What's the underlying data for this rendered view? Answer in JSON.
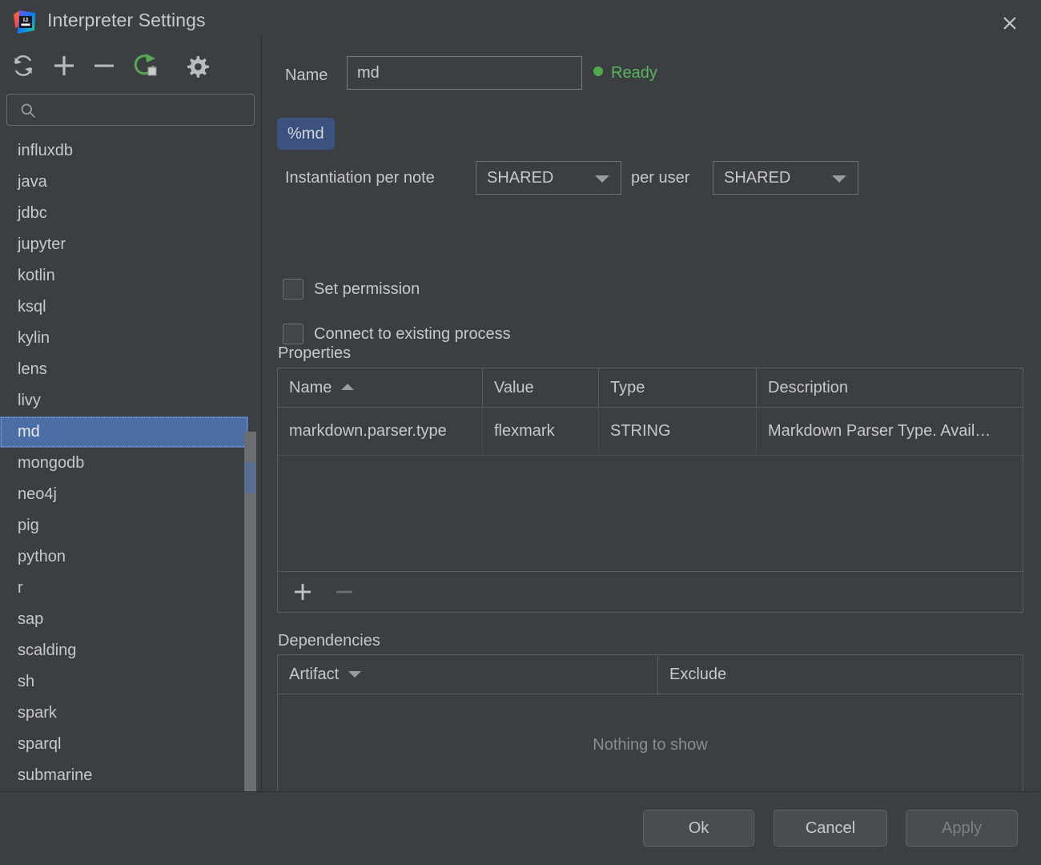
{
  "window": {
    "title": "Interpreter Settings",
    "logo_icon": "intellij-idea-logo",
    "close_icon": "close-icon"
  },
  "sidebar": {
    "toolbar": [
      {
        "name": "refresh-button",
        "icon": "refresh-icon",
        "title": "Refresh"
      },
      {
        "name": "add-button",
        "icon": "plus-icon",
        "title": "Add"
      },
      {
        "name": "remove-button",
        "icon": "minus-icon",
        "title": "Remove"
      },
      {
        "name": "restart-button",
        "icon": "restart-icon",
        "title": "Restart"
      },
      {
        "name": "settings-button",
        "icon": "gear-icon",
        "title": "Settings"
      }
    ],
    "search": {
      "value": "",
      "placeholder": "",
      "icon": "search-icon"
    },
    "items": [
      {
        "label": "influxdb",
        "selected": false
      },
      {
        "label": "java",
        "selected": false
      },
      {
        "label": "jdbc",
        "selected": false
      },
      {
        "label": "jupyter",
        "selected": false
      },
      {
        "label": "kotlin",
        "selected": false
      },
      {
        "label": "ksql",
        "selected": false
      },
      {
        "label": "kylin",
        "selected": false
      },
      {
        "label": "lens",
        "selected": false
      },
      {
        "label": "livy",
        "selected": false
      },
      {
        "label": "md",
        "selected": true
      },
      {
        "label": "mongodb",
        "selected": false
      },
      {
        "label": "neo4j",
        "selected": false
      },
      {
        "label": "pig",
        "selected": false
      },
      {
        "label": "python",
        "selected": false
      },
      {
        "label": "r",
        "selected": false
      },
      {
        "label": "sap",
        "selected": false
      },
      {
        "label": "scalding",
        "selected": false
      },
      {
        "label": "sh",
        "selected": false
      },
      {
        "label": "spark",
        "selected": false
      },
      {
        "label": "sparql",
        "selected": false
      },
      {
        "label": "submarine",
        "selected": false
      }
    ]
  },
  "detail": {
    "name_label": "Name",
    "name_value": "md",
    "status_text": "Ready",
    "status_color": "#51a94f",
    "badge": "%md",
    "instantiation_label": "Instantiation per note",
    "per_note_value": "SHARED",
    "per_user_label": "per user",
    "per_user_value": "SHARED",
    "set_permission_label": "Set permission",
    "set_permission_checked": false,
    "connect_existing_label": "Connect to existing process",
    "connect_existing_checked": false,
    "properties": {
      "title": "Properties",
      "columns": [
        "Name",
        "Value",
        "Type",
        "Description"
      ],
      "sort_column": "Name",
      "sort_direction": "asc",
      "rows": [
        {
          "name": "markdown.parser.type",
          "value": "flexmark",
          "type": "STRING",
          "description": "Markdown Parser Type. Avail…"
        }
      ],
      "add_label": "+",
      "remove_label": "−"
    },
    "dependencies": {
      "title": "Dependencies",
      "columns": [
        "Artifact",
        "Exclude"
      ],
      "sort_column": "Artifact",
      "sort_direction": "desc",
      "rows": [],
      "empty_text": "Nothing to show",
      "add_label": "+",
      "remove_label": "−"
    }
  },
  "footer": {
    "ok_label": "Ok",
    "cancel_label": "Cancel",
    "apply_label": "Apply",
    "apply_enabled": false
  },
  "colors": {
    "background": "#3c3f41",
    "selection": "#4c6ea7",
    "badge_bg": "#3b5180",
    "status_green": "#51a94f",
    "text": "#c6c8ca"
  }
}
